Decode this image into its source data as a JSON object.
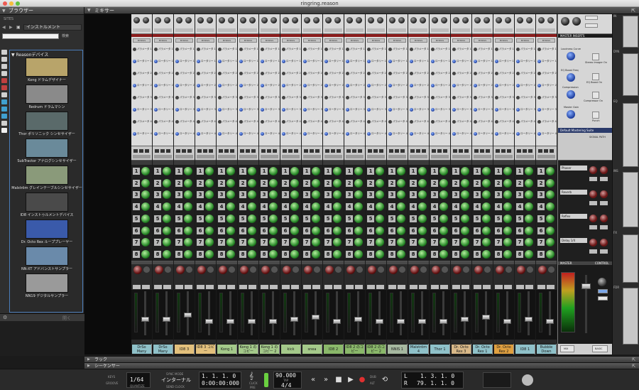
{
  "window": {
    "title": "ringring.reason"
  },
  "browser": {
    "header": "ブラウザー",
    "section_label": "SITES",
    "location": "インストルメント",
    "search_button": "検索",
    "tree_root": "Reasonデバイス",
    "devices": [
      {
        "label": "Kong ドラムデザイナー",
        "color": "#b8a46a"
      },
      {
        "label": "Redrum ドラムマシン",
        "color": "#8a8a8a"
      },
      {
        "label": "Thor ポリソニック シンセサイザー",
        "color": "#5a6a6a"
      },
      {
        "label": "SubTractor アナログシンセサイザー",
        "color": "#6a8a9a"
      },
      {
        "label": "Malström グレインテーブルシンセサイザー",
        "color": "#8a9a7a"
      },
      {
        "label": "ID8 インストゥルメントデバイス",
        "color": "#4a4a4a"
      },
      {
        "label": "Dr. Octo Rex ループプレーヤー",
        "color": "#3a5aaa"
      },
      {
        "label": "NN-XT アドバンストサンプラー",
        "color": "#6a8aaa"
      },
      {
        "label": "NN19 デジタルサンプラー",
        "color": "#9a9a9a"
      }
    ],
    "open_button": "開く"
  },
  "mixer": {
    "header": "ミキサー",
    "bypass_label": "BYPASS",
    "insert_labels": [
      "パラメータ 1",
      "ロータリー 1",
      "パラメータ 2",
      "ロータリー 2",
      "パラメータ 3",
      "ロータリー 3",
      "パラメータ 4",
      "ロータリー 4"
    ],
    "send_numbers": [
      "1",
      "2",
      "3",
      "4",
      "5",
      "6",
      "7",
      "8"
    ],
    "channels": [
      {
        "name": "DrSo Many",
        "color": "#8fc1c9"
      },
      {
        "name": "DrSo Many",
        "color": "#8fc1c9"
      },
      {
        "name": "ID8 3",
        "color": "#e3c07c"
      },
      {
        "name": "ID8 3 コピー",
        "color": "#e3c07c"
      },
      {
        "name": "Kong 1",
        "color": "#a4c98a"
      },
      {
        "name": "Kong 1 のコピー",
        "color": "#a4c98a"
      },
      {
        "name": "Kong 1 のコピー 2",
        "color": "#a4c98a"
      },
      {
        "name": "kick",
        "color": "#a4c98a"
      },
      {
        "name": "snea",
        "color": "#a4c98a"
      },
      {
        "name": "ID8 2",
        "color": "#8ab86a"
      },
      {
        "name": "ID8 2 のコピー",
        "color": "#8ab86a"
      },
      {
        "name": "ID8 2 のコピー 2",
        "color": "#8ab86a"
      },
      {
        "name": "NNIS 1",
        "color": "#a6b8a0"
      },
      {
        "name": "Malström 4",
        "color": "#8fc1c9"
      },
      {
        "name": "Thor 1",
        "color": "#8fc1c9"
      },
      {
        "name": "Dr. Octo Rex 3",
        "color": "#d8b888"
      },
      {
        "name": "Dr. Octo Rex 1",
        "color": "#8fc1c9"
      },
      {
        "name": "Dr. Octo Rex 2",
        "color": "#e0a040"
      },
      {
        "name": "ID8 1",
        "color": "#8fc1c9"
      },
      {
        "name": "Bubble Down",
        "color": "#8fc1c9"
      }
    ],
    "fader_levels": [
      0.35,
      0.35,
      0.45,
      0.3,
      0.3,
      0.3,
      0.3,
      0.35,
      0.4,
      0.3,
      0.35,
      0.3,
      0.3,
      0.3,
      0.3,
      0.35,
      0.4,
      0.3,
      0.35,
      0.3
    ],
    "master": {
      "insert_title": "MASTER INSERTS",
      "labels": [
        "Loudness Curve",
        "Stereo Imager On",
        "EQ Boost Freq",
        "EQ Boost On",
        "Compression",
        "Compressor On",
        "Master Gain",
        "Punch"
      ],
      "preset_title": "Default Mastering Suite",
      "signal_path": "SIGNAL PATH",
      "fx_returns": [
        "Phaser",
        "Reverb",
        "Reflex",
        "Delay 1/4"
      ],
      "master_title": "MASTER",
      "control_room": "CONTROL ROOM",
      "master_name": "Master",
      "bottom": [
        "MIX",
        "BASIC"
      ]
    },
    "rack_labels": [
      "IN",
      "DYN",
      "EQ",
      "INS",
      "FX",
      "FDR"
    ]
  },
  "rack": {
    "header": "ラック"
  },
  "sequencer": {
    "header": "シーケンサー"
  },
  "transport": {
    "keys_label": "KEYS",
    "groove_label": "GROOVE",
    "quantize_value": "1/64",
    "quantize_label": "QUANTIZE",
    "sync_label": "SYNC MODE",
    "sync_value": "インターナル",
    "send_clock": "SEND CLOCK",
    "position": "1.  1.  1.   0",
    "time": "0:00:00:000",
    "click_label": "CLICK",
    "pre_label": "PRE",
    "tempo": "90.000",
    "tap_label": "TAP",
    "signature": "4/4",
    "loop_left_label": "L",
    "loop_left": "1.   3.   1.   0",
    "loop_right_label": "R",
    "loop_right": "79.   1.   1.   0",
    "dub_label": "DUB",
    "alt_label": "ALT"
  }
}
